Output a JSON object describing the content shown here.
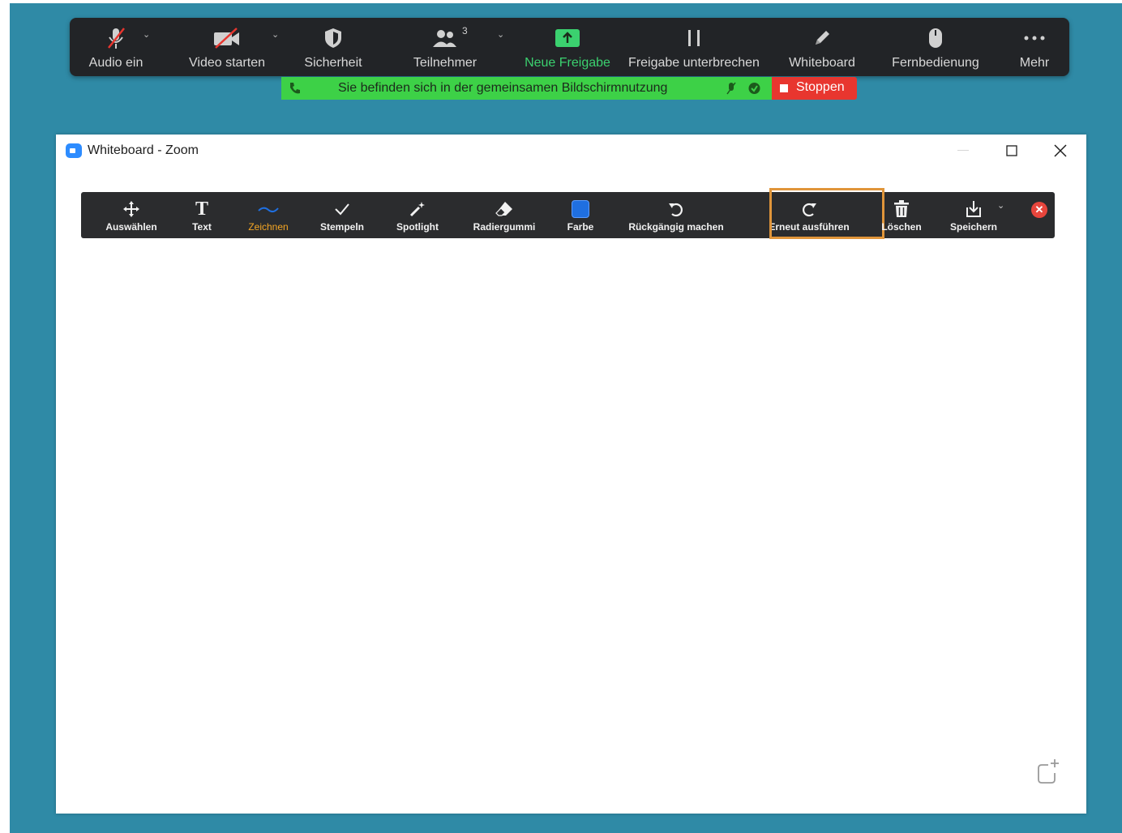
{
  "meeting_toolbar": {
    "items": [
      {
        "label": "Audio ein",
        "icon": "muted-microphone-icon"
      },
      {
        "label": "Video starten",
        "icon": "video-off-icon"
      },
      {
        "label": "Sicherheit",
        "icon": "shield-icon"
      },
      {
        "label": "Teilnehmer",
        "icon": "participants-icon",
        "count": "3"
      },
      {
        "label": "Neue Freigabe",
        "icon": "share-screen-icon"
      },
      {
        "label": "Freigabe unterbrechen",
        "icon": "pause-icon"
      },
      {
        "label": "Whiteboard",
        "icon": "pencil-icon"
      },
      {
        "label": "Fernbedienung",
        "icon": "mouse-icon"
      },
      {
        "label": "Mehr",
        "icon": "more-dots-icon"
      }
    ]
  },
  "share_bar": {
    "status_text": "Sie befinden sich in der gemeinsamen Bildschirmnutzung",
    "stop_label": "Stoppen"
  },
  "whiteboard_window": {
    "title": "Whiteboard - Zoom"
  },
  "annotation_toolbar": {
    "items": [
      {
        "label": "Auswählen",
        "icon": "move-arrows-icon"
      },
      {
        "label": "Text",
        "icon": "text-t-icon"
      },
      {
        "label": "Zeichnen",
        "icon": "draw-squiggle-icon",
        "active": true
      },
      {
        "label": "Stempeln",
        "icon": "checkmark-stamp-icon"
      },
      {
        "label": "Spotlight",
        "icon": "spotlight-wand-icon"
      },
      {
        "label": "Radiergummi",
        "icon": "eraser-icon"
      },
      {
        "label": "Farbe",
        "icon": "color-swatch-icon"
      },
      {
        "label": "Rückgängig machen",
        "icon": "undo-icon"
      },
      {
        "label": "Erneut ausführen",
        "icon": "redo-icon",
        "highlighted": true
      },
      {
        "label": "Löschen",
        "icon": "trash-icon"
      },
      {
        "label": "Speichern",
        "icon": "save-download-icon"
      }
    ]
  },
  "colors": {
    "desktop": "#2f8aa6",
    "share_bar_green": "#3dd147",
    "stop_red": "#e8362f",
    "active_tool": "#f5a623",
    "selected_color": "#1f6fe0",
    "highlight_box": "#e0953a"
  }
}
